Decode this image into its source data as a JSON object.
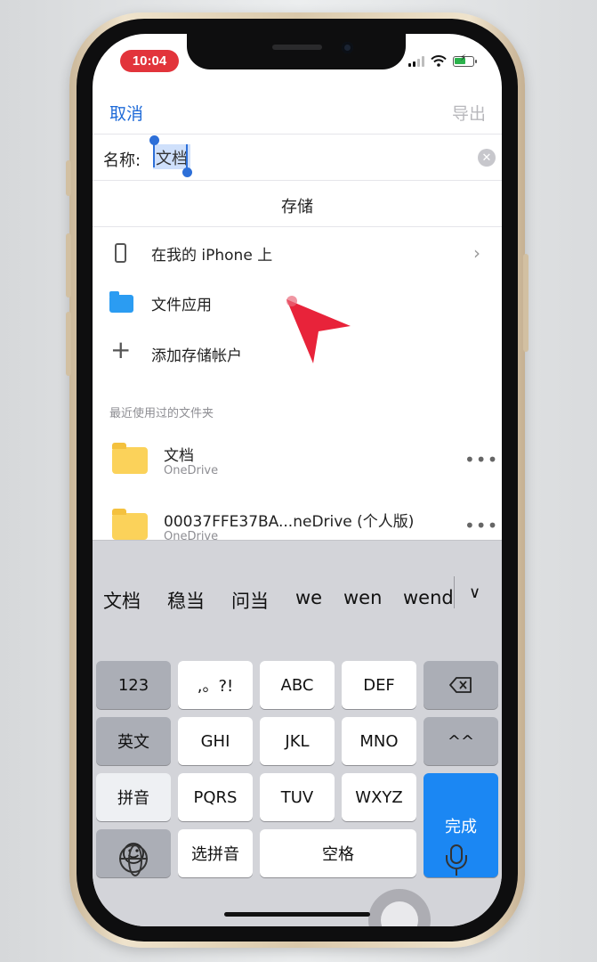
{
  "status_bar": {
    "time": "10:04"
  },
  "nav": {
    "cancel": "取消",
    "export": "导出"
  },
  "name_field": {
    "label": "名称:",
    "value": "文档"
  },
  "storage": {
    "title": "存储",
    "locations": [
      {
        "label": "在我的 iPhone 上",
        "icon": "phone-icon"
      },
      {
        "label": "文件应用",
        "icon": "folder-icon"
      },
      {
        "label": "添加存储帐户",
        "icon": "plus-icon"
      }
    ]
  },
  "recent": {
    "header": "最近使用过的文件夹",
    "items": [
      {
        "title": "文档",
        "subtitle": "OneDrive"
      },
      {
        "title": "00037FFE37BA...neDrive (个人版)",
        "subtitle": "OneDrive"
      }
    ]
  },
  "keyboard": {
    "suggestions": [
      "文档",
      "稳当",
      "问当",
      "we",
      "wen",
      "wend"
    ],
    "rows": [
      [
        "123",
        ",。?!",
        "ABC",
        "DEF"
      ],
      [
        "英文",
        "GHI",
        "JKL",
        "MNO",
        "^^"
      ],
      [
        "拼音",
        "PQRS",
        "TUV",
        "WXYZ"
      ],
      [
        "选拼音",
        "空格"
      ]
    ],
    "done": "完成"
  },
  "colors": {
    "accent": "#1f6bd8",
    "done_key": "#1b87f3",
    "time_badge": "#e2343b"
  }
}
